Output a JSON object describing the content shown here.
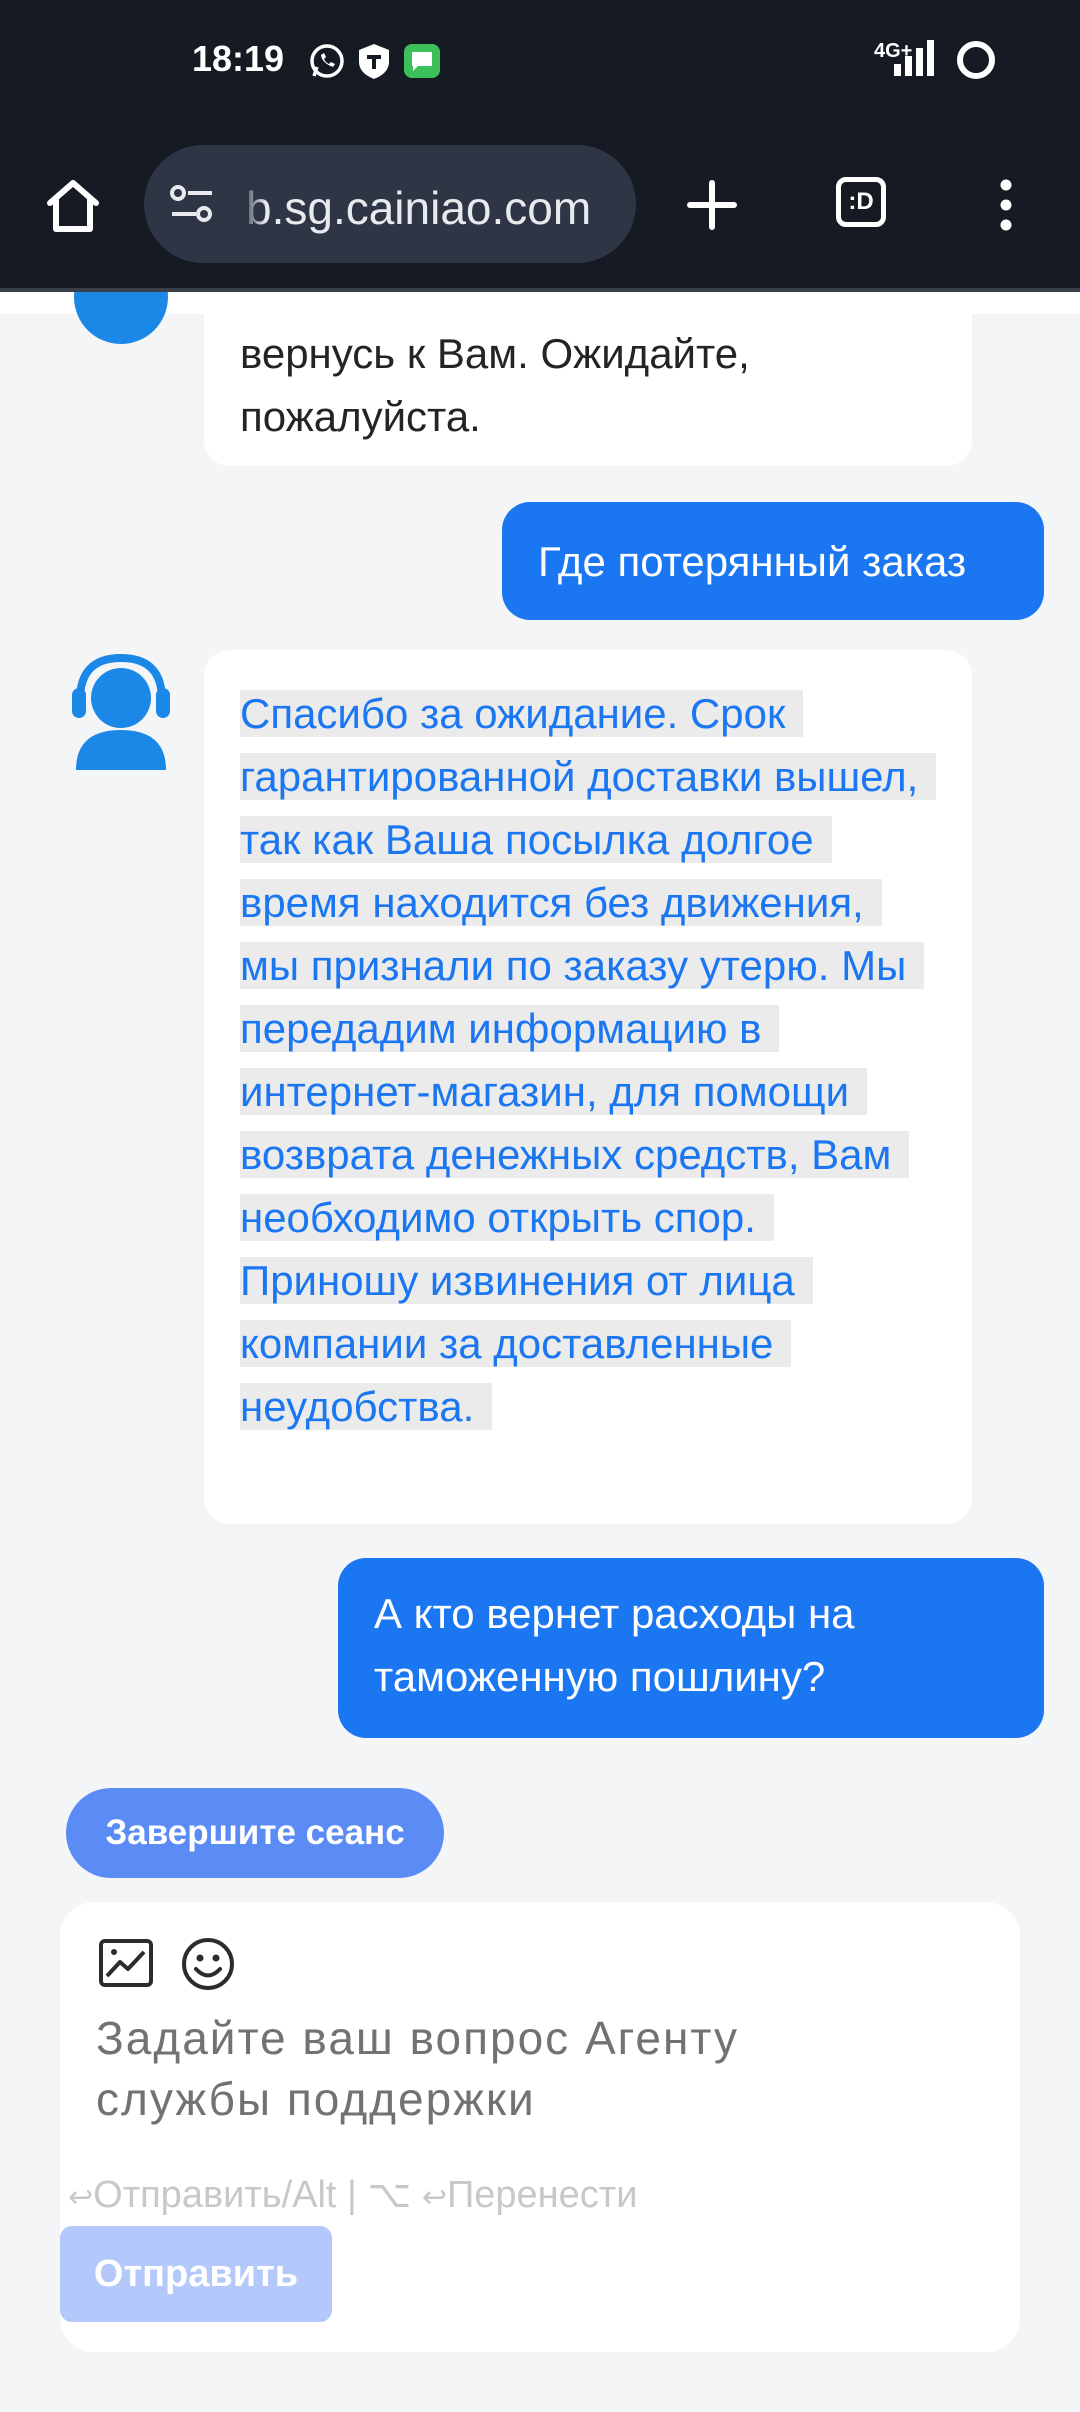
{
  "status_bar": {
    "time": "18:19",
    "network": "4G+",
    "notification_icons": [
      "whatsapp-icon",
      "vpn-key-icon",
      "messages-icon"
    ]
  },
  "browser": {
    "url": "b.sg.cainiao.com",
    "tab_label": ":D"
  },
  "chat": {
    "messages": [
      {
        "sender": "agent",
        "text": "вернусь к Вам. Ожидайте, пожалуйста."
      },
      {
        "sender": "user",
        "text": "Где потерянный заказ"
      },
      {
        "sender": "agent",
        "text": "Спасибо за ожидание. Срок гарантированной доставки вышел, так как Ваша посылка долгое время находится без движения, мы признали по заказу утерю. Мы передадим информацию в интернет-магазин, для помощи возврата денежных средств, Вам необходимо открыть спор. Приношу извинения от лица компании за доставленные неудобства."
      },
      {
        "sender": "user",
        "text": "А кто вернет расходы на таможенную пошлину?"
      }
    ]
  },
  "end_session_label": "Завершите сеанс",
  "composer": {
    "placeholder": "Задайте ваш вопрос Агенту службы поддержки",
    "hint_send": "Отправить/Alt | ⌥ ",
    "hint_newline": "Перенести",
    "send_label": "Отправить"
  },
  "colors": {
    "accent": "#1b76f2",
    "end_button": "#5b8cf5",
    "send_disabled": "#b4c8fb",
    "topbar": "#151a23",
    "page_bg": "#f4f5f7"
  }
}
